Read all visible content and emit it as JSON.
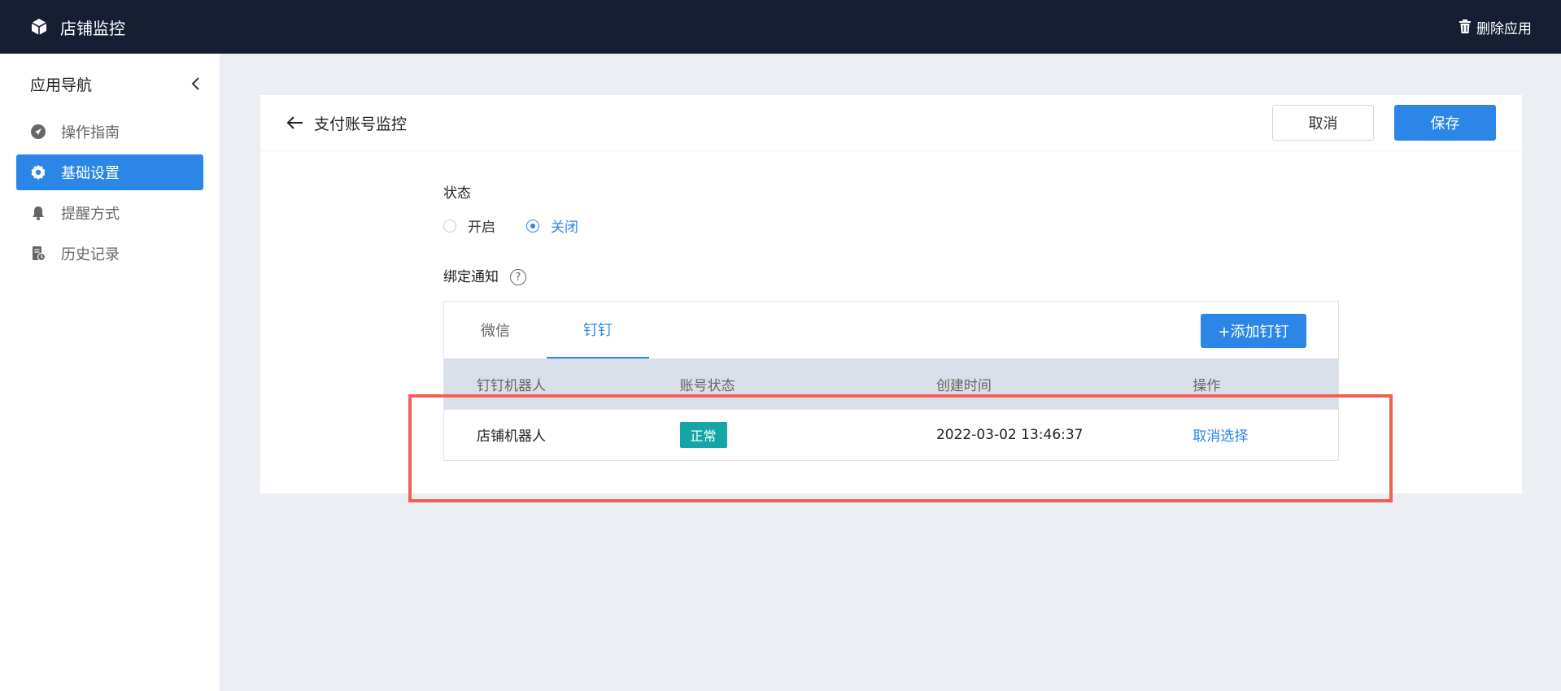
{
  "header": {
    "app_title": "店铺监控",
    "delete_label": "删除应用"
  },
  "sidebar": {
    "title": "应用导航",
    "items": [
      {
        "label": "操作指南",
        "icon": "navigation-icon"
      },
      {
        "label": "基础设置",
        "icon": "gear-icon",
        "active": true
      },
      {
        "label": "提醒方式",
        "icon": "bell-icon"
      },
      {
        "label": "历史记录",
        "icon": "history-icon"
      }
    ]
  },
  "page": {
    "title": "支付账号监控",
    "cancel_label": "取消",
    "save_label": "保存",
    "status_label": "状态",
    "status_options": [
      {
        "label": "开启",
        "checked": false
      },
      {
        "label": "关闭",
        "checked": true
      }
    ],
    "bind_label": "绑定通知",
    "tabs": [
      {
        "label": "微信",
        "active": false
      },
      {
        "label": "钉钉",
        "active": true
      }
    ],
    "add_button": "+添加钉钉",
    "table": {
      "columns": [
        "钉钉机器人",
        "账号状态",
        "创建时间",
        "操作"
      ],
      "rows": [
        {
          "name": "店铺机器人",
          "status": "正常",
          "created": "2022-03-02 13:46:37",
          "action": "取消选择"
        }
      ]
    }
  },
  "colors": {
    "primary": "#2b86e8",
    "topbar": "#161e33",
    "badge": "#15a5a6",
    "highlight": "#f06153"
  }
}
